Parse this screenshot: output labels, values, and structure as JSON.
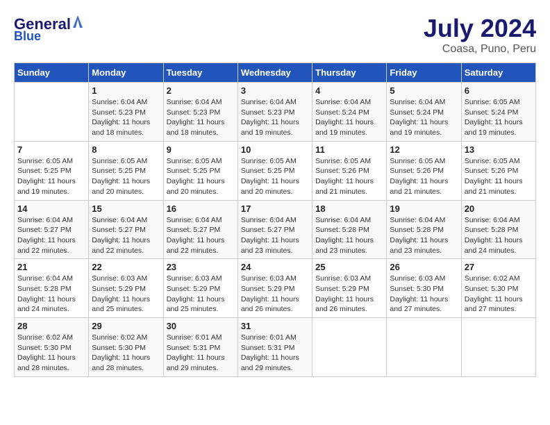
{
  "header": {
    "logo_line1": "General",
    "logo_line2": "Blue",
    "title": "July 2024",
    "subtitle": "Coasa, Puno, Peru"
  },
  "columns": [
    "Sunday",
    "Monday",
    "Tuesday",
    "Wednesday",
    "Thursday",
    "Friday",
    "Saturday"
  ],
  "weeks": [
    [
      {
        "day": "",
        "info": ""
      },
      {
        "day": "1",
        "info": "Sunrise: 6:04 AM\nSunset: 5:23 PM\nDaylight: 11 hours\nand 18 minutes."
      },
      {
        "day": "2",
        "info": "Sunrise: 6:04 AM\nSunset: 5:23 PM\nDaylight: 11 hours\nand 18 minutes."
      },
      {
        "day": "3",
        "info": "Sunrise: 6:04 AM\nSunset: 5:23 PM\nDaylight: 11 hours\nand 19 minutes."
      },
      {
        "day": "4",
        "info": "Sunrise: 6:04 AM\nSunset: 5:24 PM\nDaylight: 11 hours\nand 19 minutes."
      },
      {
        "day": "5",
        "info": "Sunrise: 6:04 AM\nSunset: 5:24 PM\nDaylight: 11 hours\nand 19 minutes."
      },
      {
        "day": "6",
        "info": "Sunrise: 6:05 AM\nSunset: 5:24 PM\nDaylight: 11 hours\nand 19 minutes."
      }
    ],
    [
      {
        "day": "7",
        "info": "Sunrise: 6:05 AM\nSunset: 5:25 PM\nDaylight: 11 hours\nand 19 minutes."
      },
      {
        "day": "8",
        "info": "Sunrise: 6:05 AM\nSunset: 5:25 PM\nDaylight: 11 hours\nand 20 minutes."
      },
      {
        "day": "9",
        "info": "Sunrise: 6:05 AM\nSunset: 5:25 PM\nDaylight: 11 hours\nand 20 minutes."
      },
      {
        "day": "10",
        "info": "Sunrise: 6:05 AM\nSunset: 5:25 PM\nDaylight: 11 hours\nand 20 minutes."
      },
      {
        "day": "11",
        "info": "Sunrise: 6:05 AM\nSunset: 5:26 PM\nDaylight: 11 hours\nand 21 minutes."
      },
      {
        "day": "12",
        "info": "Sunrise: 6:05 AM\nSunset: 5:26 PM\nDaylight: 11 hours\nand 21 minutes."
      },
      {
        "day": "13",
        "info": "Sunrise: 6:05 AM\nSunset: 5:26 PM\nDaylight: 11 hours\nand 21 minutes."
      }
    ],
    [
      {
        "day": "14",
        "info": "Sunrise: 6:04 AM\nSunset: 5:27 PM\nDaylight: 11 hours\nand 22 minutes."
      },
      {
        "day": "15",
        "info": "Sunrise: 6:04 AM\nSunset: 5:27 PM\nDaylight: 11 hours\nand 22 minutes."
      },
      {
        "day": "16",
        "info": "Sunrise: 6:04 AM\nSunset: 5:27 PM\nDaylight: 11 hours\nand 22 minutes."
      },
      {
        "day": "17",
        "info": "Sunrise: 6:04 AM\nSunset: 5:27 PM\nDaylight: 11 hours\nand 23 minutes."
      },
      {
        "day": "18",
        "info": "Sunrise: 6:04 AM\nSunset: 5:28 PM\nDaylight: 11 hours\nand 23 minutes."
      },
      {
        "day": "19",
        "info": "Sunrise: 6:04 AM\nSunset: 5:28 PM\nDaylight: 11 hours\nand 23 minutes."
      },
      {
        "day": "20",
        "info": "Sunrise: 6:04 AM\nSunset: 5:28 PM\nDaylight: 11 hours\nand 24 minutes."
      }
    ],
    [
      {
        "day": "21",
        "info": "Sunrise: 6:04 AM\nSunset: 5:28 PM\nDaylight: 11 hours\nand 24 minutes."
      },
      {
        "day": "22",
        "info": "Sunrise: 6:03 AM\nSunset: 5:29 PM\nDaylight: 11 hours\nand 25 minutes."
      },
      {
        "day": "23",
        "info": "Sunrise: 6:03 AM\nSunset: 5:29 PM\nDaylight: 11 hours\nand 25 minutes."
      },
      {
        "day": "24",
        "info": "Sunrise: 6:03 AM\nSunset: 5:29 PM\nDaylight: 11 hours\nand 26 minutes."
      },
      {
        "day": "25",
        "info": "Sunrise: 6:03 AM\nSunset: 5:29 PM\nDaylight: 11 hours\nand 26 minutes."
      },
      {
        "day": "26",
        "info": "Sunrise: 6:03 AM\nSunset: 5:30 PM\nDaylight: 11 hours\nand 27 minutes."
      },
      {
        "day": "27",
        "info": "Sunrise: 6:02 AM\nSunset: 5:30 PM\nDaylight: 11 hours\nand 27 minutes."
      }
    ],
    [
      {
        "day": "28",
        "info": "Sunrise: 6:02 AM\nSunset: 5:30 PM\nDaylight: 11 hours\nand 28 minutes."
      },
      {
        "day": "29",
        "info": "Sunrise: 6:02 AM\nSunset: 5:30 PM\nDaylight: 11 hours\nand 28 minutes."
      },
      {
        "day": "30",
        "info": "Sunrise: 6:01 AM\nSunset: 5:31 PM\nDaylight: 11 hours\nand 29 minutes."
      },
      {
        "day": "31",
        "info": "Sunrise: 6:01 AM\nSunset: 5:31 PM\nDaylight: 11 hours\nand 29 minutes."
      },
      {
        "day": "",
        "info": ""
      },
      {
        "day": "",
        "info": ""
      },
      {
        "day": "",
        "info": ""
      }
    ]
  ]
}
